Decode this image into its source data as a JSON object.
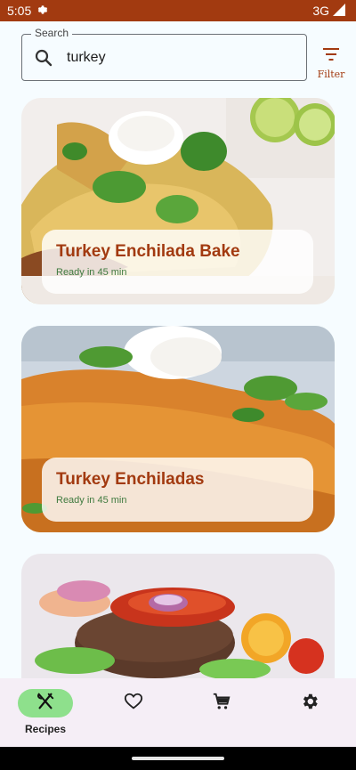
{
  "status_bar": {
    "time": "5:05",
    "network": "3G"
  },
  "search": {
    "label": "Search",
    "value": "turkey"
  },
  "filter": {
    "label": "Filter"
  },
  "recipes": [
    {
      "title": "Turkey Enchilada Bake",
      "subtitle": "Ready in 45 min"
    },
    {
      "title": "Turkey Enchiladas",
      "subtitle": "Ready in 45 min"
    },
    {
      "title": "",
      "subtitle": ""
    }
  ],
  "bottom_nav": {
    "items": [
      {
        "label": "Recipes",
        "icon": "fork-knife-icon",
        "active": true
      },
      {
        "label": "",
        "icon": "heart-icon",
        "active": false
      },
      {
        "label": "",
        "icon": "cart-icon",
        "active": false
      },
      {
        "label": "",
        "icon": "gear-icon",
        "active": false
      }
    ]
  },
  "colors": {
    "accent": "#a23a10",
    "nav_active": "#8ee08c",
    "subtitle": "#3f7a3f"
  }
}
